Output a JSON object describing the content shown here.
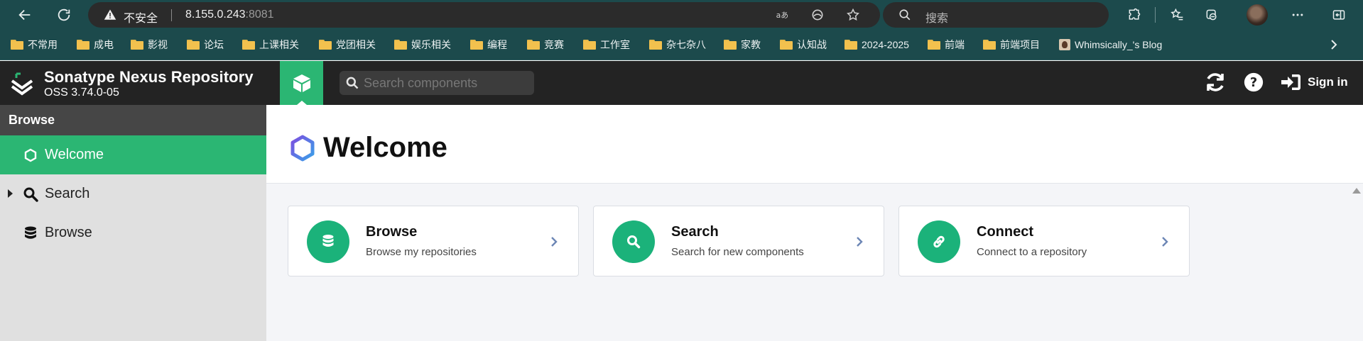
{
  "browser": {
    "insecure_label": "不安全",
    "url_host": "8.155.0.243",
    "url_port": ":8081",
    "search_placeholder": "搜索",
    "bookmarks": [
      "不常用",
      "成电",
      "影视",
      "论坛",
      "上课相关",
      "党团相关",
      "娱乐相关",
      "编程",
      "竞赛",
      "工作室",
      "杂七杂八",
      "家教",
      "认知战",
      "2024-2025",
      "前端",
      "前端项目",
      "Whimsically_'s Blog"
    ]
  },
  "header": {
    "app_title": "Sonatype Nexus Repository",
    "version": "OSS 3.74.0-05",
    "search_placeholder": "Search components",
    "signin_label": "Sign in"
  },
  "sidebar": {
    "heading": "Browse",
    "items": [
      {
        "label": "Welcome",
        "icon": "hexagon-icon",
        "active": true
      },
      {
        "label": "Search",
        "icon": "search-icon",
        "active": false,
        "expandable": true
      },
      {
        "label": "Browse",
        "icon": "database-icon",
        "active": false
      }
    ]
  },
  "main": {
    "title": "Welcome",
    "cards": [
      {
        "title": "Browse",
        "subtitle": "Browse my repositories",
        "icon": "database-icon"
      },
      {
        "title": "Search",
        "subtitle": "Search for new components",
        "icon": "search-icon"
      },
      {
        "title": "Connect",
        "subtitle": "Connect to a repository",
        "icon": "link-icon"
      }
    ]
  },
  "colors": {
    "browser_chrome": "#1c4a4c",
    "nexus_header": "#232323",
    "accent_green": "#2bb673",
    "card_icon_green": "#1bb27a",
    "sidebar_bg": "#e0e0e0",
    "sidebar_head": "#464646"
  }
}
